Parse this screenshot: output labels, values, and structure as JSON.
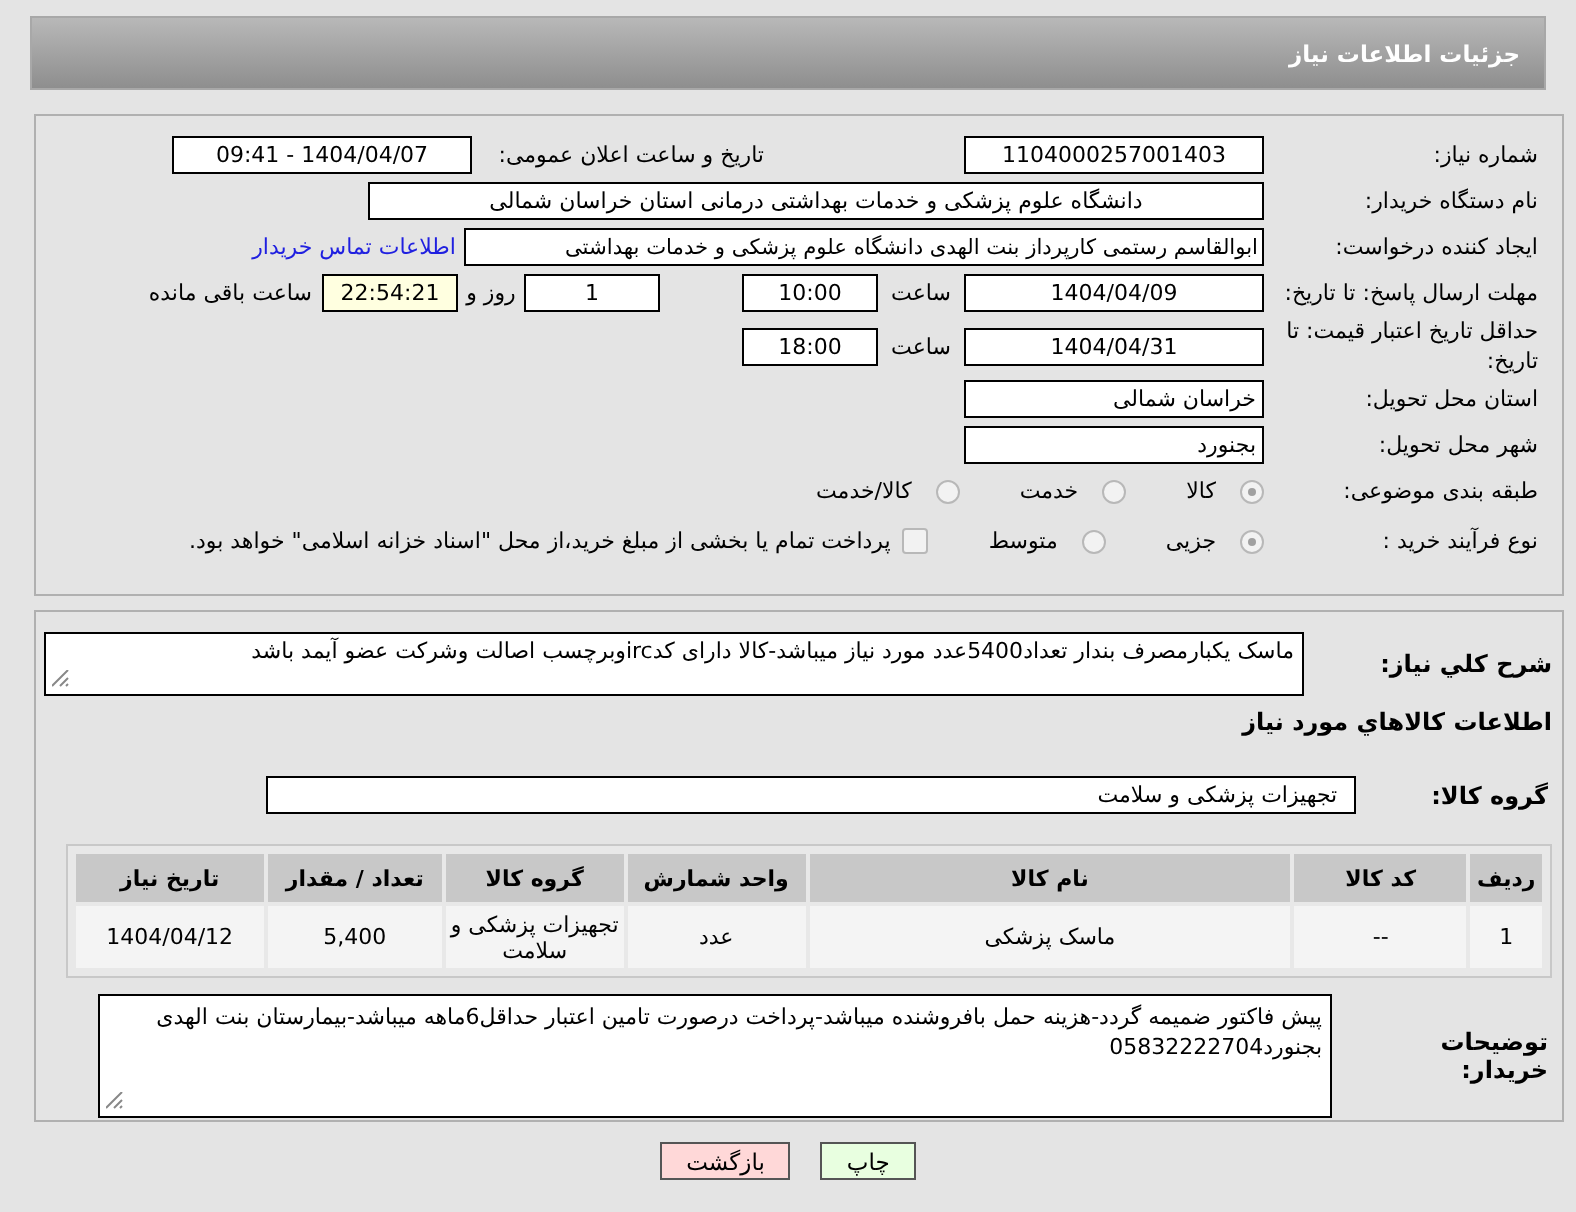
{
  "header": {
    "title": "جزئیات اطلاعات نیاز"
  },
  "need_number": {
    "label": "شماره نیاز:",
    "value": "1104000257001403"
  },
  "announce": {
    "label": "تاریخ و ساعت اعلان عمومی:",
    "value": "1404/04/07 - 09:41"
  },
  "buyer_org": {
    "label": "نام دستگاه خریدار:",
    "value": "دانشگاه علوم پزشکی و خدمات بهداشتی درمانی استان خراسان شمالی"
  },
  "requester": {
    "label": "ایجاد کننده درخواست:",
    "value": "ابوالقاسم رستمی کارپرداز بنت الهدی دانشگاه علوم پزشکی و خدمات بهداشتی",
    "link": "اطلاعات تماس خریدار"
  },
  "reply_deadline": {
    "label": "مهلت ارسال پاسخ: تا تاریخ:",
    "date": "1404/04/09",
    "time_label": "ساعت",
    "time": "10:00",
    "days": "1",
    "days_label": "روز و",
    "remaining": "22:54:21",
    "remaining_label": "ساعت باقی مانده"
  },
  "price_validity": {
    "label": "حداقل تاریخ اعتبار قیمت: تا تاریخ:",
    "date": "1404/04/31",
    "time_label": "ساعت",
    "time": "18:00"
  },
  "province": {
    "label": "استان محل تحویل:",
    "value": "خراسان شمالی"
  },
  "city": {
    "label": "شهر محل تحویل:",
    "value": "بجنورد"
  },
  "category": {
    "label": "طبقه بندی موضوعی:",
    "options": [
      {
        "label": "کالا",
        "selected": true
      },
      {
        "label": "خدمت",
        "selected": false
      },
      {
        "label": "کالا/خدمت",
        "selected": false
      }
    ]
  },
  "process": {
    "label": "نوع فرآیند خرید :",
    "options": [
      {
        "label": "جزیی",
        "selected": true
      },
      {
        "label": "متوسط",
        "selected": false
      }
    ],
    "payment": {
      "checked": false,
      "text": "پرداخت تمام یا بخشی از مبلغ خرید،از محل \"اسناد خزانه اسلامی\" خواهد بود."
    }
  },
  "description": {
    "label": "شرح کلي نياز:",
    "value": "ماسک یکبارمصرف بندار تعداد5400عدد مورد نیاز میباشد-کالا دارای کدircوبرچسب اصالت وشرکت عضو آیمد باشد"
  },
  "goods_heading": "اطلاعات کالاهاي مورد نياز",
  "goods_group": {
    "label": "گروه کالا:",
    "value": "تجهیزات پزشکی و سلامت"
  },
  "table": {
    "columns": [
      "ردیف",
      "کد کالا",
      "نام کالا",
      "واحد شمارش",
      "گروه کالا",
      "تعداد / مقدار",
      "تاریخ نیاز"
    ],
    "rows": [
      [
        "1",
        "--",
        "ماسک پزشکی",
        "عدد",
        "تجهیزات پزشکی و سلامت",
        "5,400",
        "1404/04/12"
      ]
    ]
  },
  "buyer_notes": {
    "label": "توضیحات خریدار:",
    "value": "پیش فاکتور ضمیمه گردد-هزینه حمل بافروشنده میباشد-پرداخت درصورت تامین اعتبار حداقل6ماهه میباشد-بیمارستان بنت الهدی بجنورد05832222704"
  },
  "buttons": [
    {
      "label": "چاپ",
      "kind": "print"
    },
    {
      "label": "بازگشت",
      "kind": "back"
    }
  ]
}
